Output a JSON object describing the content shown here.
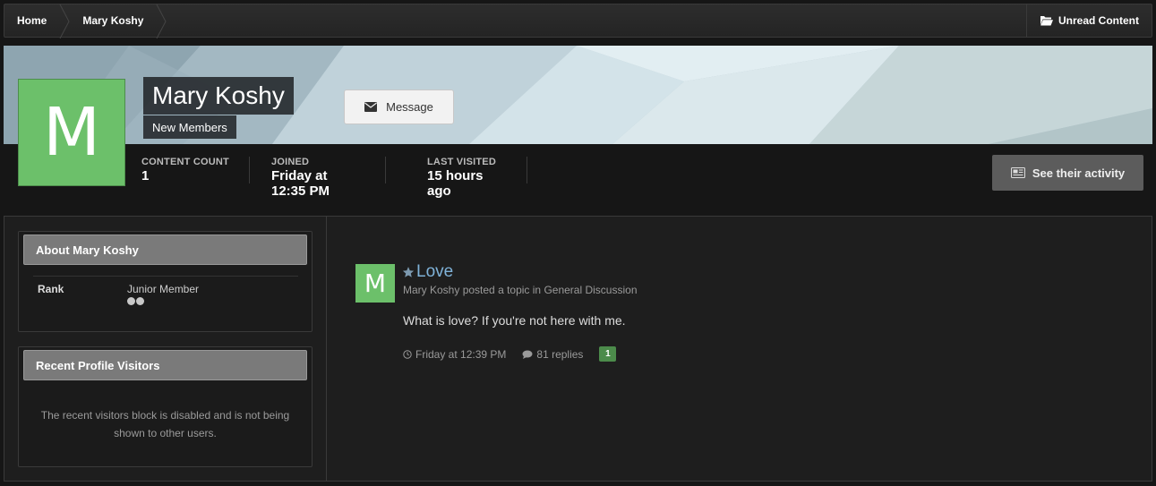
{
  "breadcrumb": {
    "items": [
      {
        "label": "Home"
      },
      {
        "label": "Mary Koshy"
      }
    ],
    "unread_label": "Unread Content"
  },
  "profile": {
    "avatar_letter": "M",
    "name": "Mary Koshy",
    "group": "New Members",
    "message_label": "Message",
    "stats": [
      {
        "label": "CONTENT COUNT",
        "value": "1"
      },
      {
        "label": "JOINED",
        "value": "Friday at 12:35 PM"
      },
      {
        "label": "LAST VISITED",
        "value": "15 hours ago"
      }
    ],
    "activity_label": "See their activity"
  },
  "sidebar": {
    "about": {
      "title": "About Mary Koshy",
      "rank_label": "Rank",
      "rank_value": "Junior Member",
      "rank_pips": 2
    },
    "visitors": {
      "title": "Recent Profile Visitors",
      "message": "The recent visitors block is disabled and is not being shown to other users."
    }
  },
  "activity": {
    "avatar_letter": "M",
    "title": "Love",
    "author": "Mary Koshy",
    "action": "posted a topic in",
    "forum": "General Discussion",
    "snippet": "What is love? If you're not here with me.",
    "time": "Friday at 12:39 PM",
    "replies": "81 replies",
    "badge": "1"
  },
  "colors": {
    "accent_link": "#7fb2d8",
    "avatar_green": "#6cc06a",
    "badge_green": "#4c8b4b"
  }
}
